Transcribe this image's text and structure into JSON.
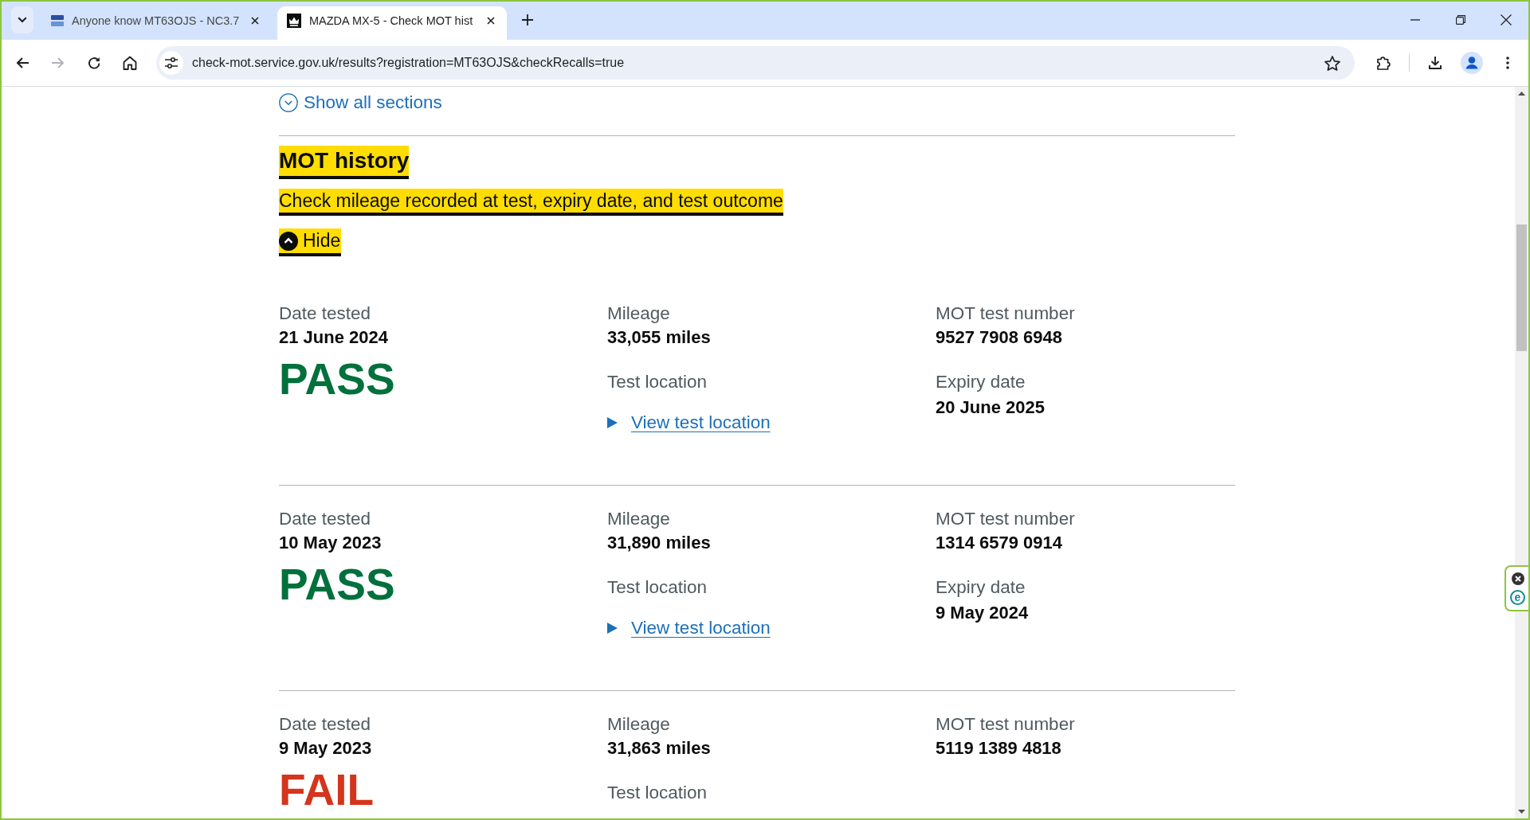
{
  "tabs": [
    {
      "title": "Anyone know MT63OJS - NC3.7",
      "kind": "forum",
      "selected": false
    },
    {
      "title": "MAZDA MX-5 - Check MOT hist",
      "kind": "government",
      "selected": true
    }
  ],
  "toolbar": {
    "back": {
      "disabled": false
    },
    "forward": {
      "disabled": true
    },
    "address": "check-mot.service.gov.uk/results?registration=MT63OJS&checkRecalls=true",
    "bookmarked": false
  },
  "page": {
    "show_all": "Show all sections",
    "section": {
      "title": "MOT history",
      "summary": "Check mileage recorded at test, expiry date, and test outcome",
      "toggle": "Hide",
      "expanded": true,
      "focused": true
    },
    "tests": [
      {
        "date_tested": {
          "label": "Date tested",
          "value": "21 June 2024"
        },
        "result": {
          "text": "PASS",
          "passed": true
        },
        "mileage": {
          "label": "Mileage",
          "value": "33,055 miles"
        },
        "test_location": {
          "label": "Test location",
          "link": "View test location",
          "expanded": false
        },
        "test_number": {
          "label": "MOT test number",
          "value": "9527 7908 6948"
        },
        "expiry_date": {
          "label": "Expiry date",
          "value": "20 June 2025"
        }
      },
      {
        "date_tested": {
          "label": "Date tested",
          "value": "10 May 2023"
        },
        "result": {
          "text": "PASS",
          "passed": true
        },
        "mileage": {
          "label": "Mileage",
          "value": "31,890 miles"
        },
        "test_location": {
          "label": "Test location",
          "link": "View test location",
          "expanded": false
        },
        "test_number": {
          "label": "MOT test number",
          "value": "1314 6579 0914"
        },
        "expiry_date": {
          "label": "Expiry date",
          "value": "9 May 2024"
        }
      },
      {
        "date_tested": {
          "label": "Date tested",
          "value": "9 May 2023"
        },
        "result": {
          "text": "FAIL",
          "passed": false
        },
        "mileage": {
          "label": "Mileage",
          "value": "31,863 miles"
        },
        "test_location": {
          "label": "Test location"
        },
        "test_number": {
          "label": "MOT test number",
          "value": "5119 1389 4818"
        }
      }
    ]
  },
  "extension_badge": {
    "logo": "e"
  }
}
